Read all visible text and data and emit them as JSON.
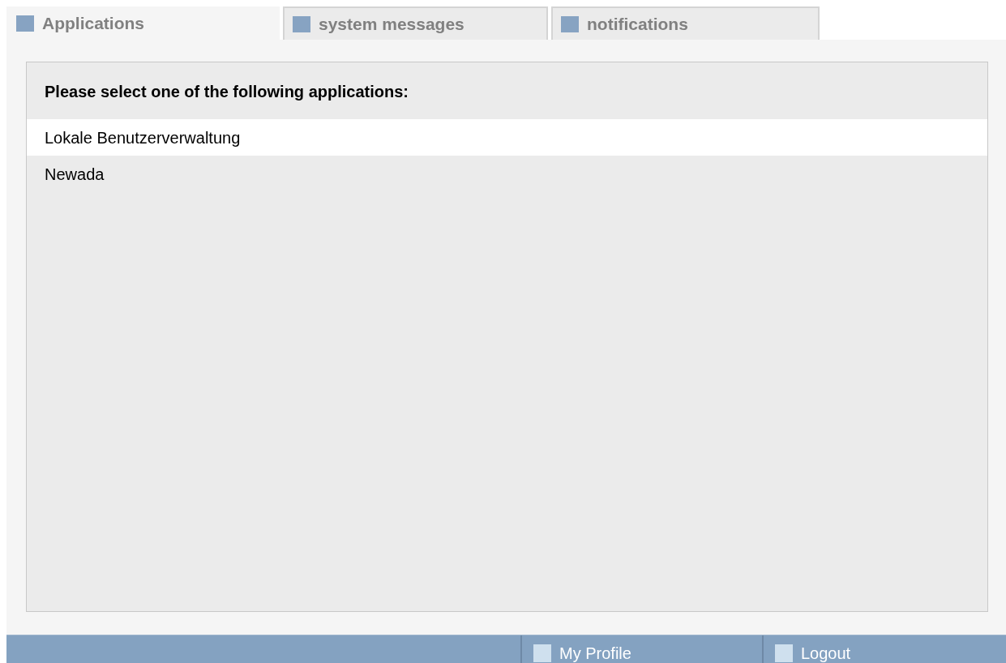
{
  "tabs": [
    {
      "label": "Applications",
      "selected": true
    },
    {
      "label": "system messages",
      "selected": false
    },
    {
      "label": "notifications",
      "selected": false
    }
  ],
  "panel": {
    "heading": "Please select one of the following applications:",
    "items": [
      {
        "label": "Lokale Benutzerverwaltung",
        "selected": true
      },
      {
        "label": "Newada",
        "selected": false
      }
    ]
  },
  "footer": {
    "links": [
      "My Profile",
      "Logout"
    ]
  }
}
